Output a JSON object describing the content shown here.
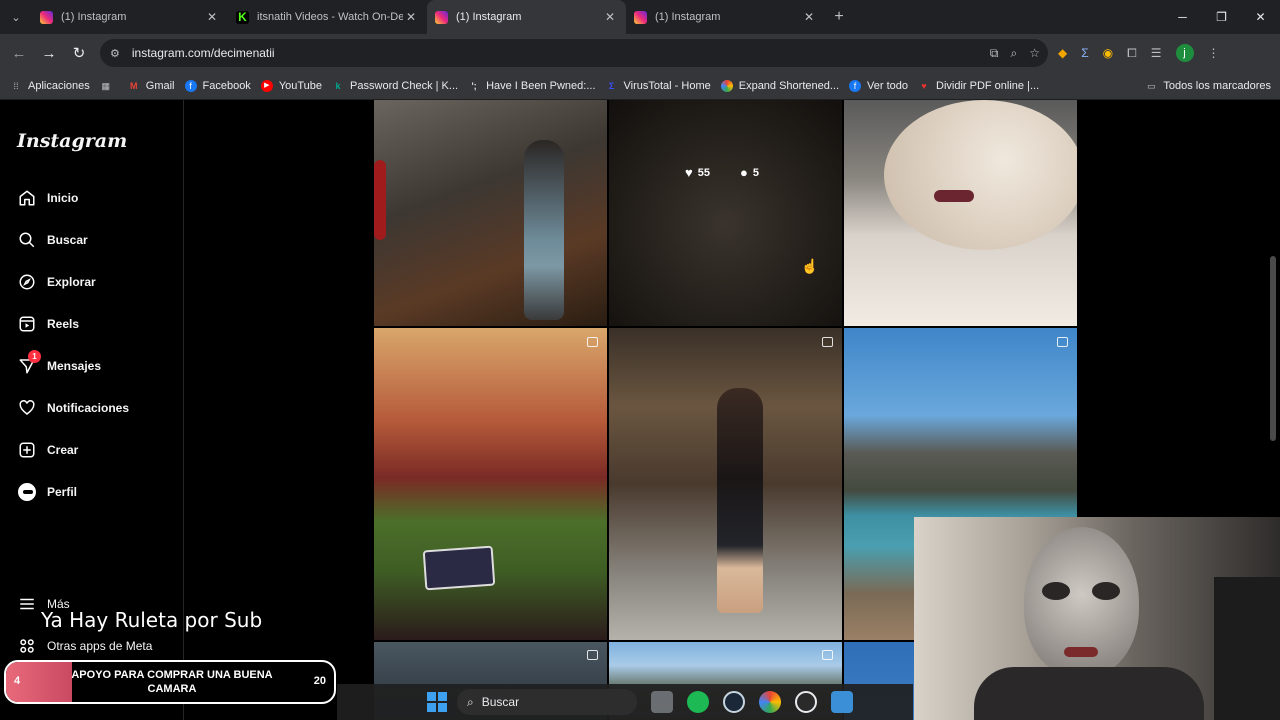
{
  "browser": {
    "tabs": [
      {
        "title": "(1) Instagram",
        "favicon": "instagram-icon",
        "active": false
      },
      {
        "title": "itsnatih Videos - Watch On-Dem",
        "favicon": "kick-icon",
        "active": false
      },
      {
        "title": "(1) Instagram",
        "favicon": "instagram-icon",
        "active": true
      },
      {
        "title": "(1) Instagram",
        "favicon": "instagram-icon",
        "active": false
      }
    ],
    "url": "instagram.com/decimenatii",
    "profile_initial": "j",
    "bookmarks": [
      {
        "label": "Aplicaciones",
        "icon": "apps-grid-icon"
      },
      {
        "label": "",
        "icon": "grid-icon"
      },
      {
        "label": "Gmail",
        "icon": "gmail-icon"
      },
      {
        "label": "Facebook",
        "icon": "facebook-icon"
      },
      {
        "label": "YouTube",
        "icon": "youtube-icon"
      },
      {
        "label": "Password Check | K...",
        "icon": "kaspersky-icon"
      },
      {
        "label": "Have I Been Pwned:...",
        "icon": "haveibeenpwned-icon"
      },
      {
        "label": "VirusTotal - Home",
        "icon": "virustotal-icon"
      },
      {
        "label": "Expand Shortened...",
        "icon": "expand-icon"
      },
      {
        "label": "Ver todo",
        "icon": "facebook-icon"
      },
      {
        "label": "Dividir PDF online |...",
        "icon": "pdf-icon"
      }
    ],
    "all_bookmarks": "Todos los marcadores"
  },
  "instagram": {
    "logo": "Instagram",
    "nav": [
      {
        "label": "Inicio",
        "icon": "home-icon"
      },
      {
        "label": "Buscar",
        "icon": "search-icon"
      },
      {
        "label": "Explorar",
        "icon": "compass-icon"
      },
      {
        "label": "Reels",
        "icon": "reels-icon"
      },
      {
        "label": "Mensajes",
        "icon": "messenger-icon",
        "badge": "1"
      },
      {
        "label": "Notificaciones",
        "icon": "heart-icon"
      },
      {
        "label": "Crear",
        "icon": "plus-square-icon"
      },
      {
        "label": "Perfil",
        "icon": "profile-icon"
      }
    ],
    "more": {
      "label": "Más",
      "icon": "menu-icon"
    },
    "meta_apps": {
      "label": "Otras apps de Meta",
      "icon": "meta-apps-icon"
    },
    "hover_stats": {
      "likes": "55",
      "comments": "5"
    }
  },
  "overlay": {
    "subtitle": "Ya Hay Ruleta por Sub",
    "goal": {
      "title": "APOYO PARA COMPRAR UNA BUENA CAMARA",
      "current": "4",
      "target": "20",
      "progress": 0.2
    }
  },
  "taskbar": {
    "search_placeholder": "Buscar"
  }
}
